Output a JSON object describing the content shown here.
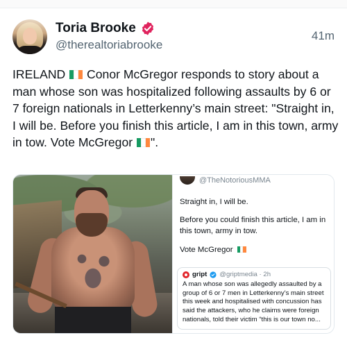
{
  "post": {
    "author_name": "Toria Brooke",
    "author_handle": "@therealtoriabrooke",
    "time": "41m",
    "text_parts": [
      "IRELAND",
      "Conor McGregor responds to story about a man whose son was hospitalized following assaults by 6 or 7 foreign nationals in Letterkenny’s main street: \"Straight in, I will be. Before you finish this article, I am in this town, army in tow. Vote McGregor",
      "\"."
    ]
  },
  "media": {
    "photo_icon": "man-holding-axe-photo",
    "quote": {
      "handle": "@TheNotoriousMMA",
      "line1": "Straight in, I will be.",
      "line2": "Before you could finish this article, I am in this town, army in tow.",
      "line3": "Vote McGregor",
      "inner": {
        "name": "gript",
        "meta": "@griptmedia · 2h",
        "text": "A man whose son was allegedly assaulted by a group of 6 or 7 men in Letterkenny’s main street this week and hospitalised with concussion has said the attackers, who he claims were foreign nationals, told their victim “this is our town no..."
      }
    }
  },
  "colors": {
    "verified_badge": "#e0245e",
    "flag_green": "#169b62",
    "flag_white": "#ffffff",
    "flag_orange": "#ff883e",
    "inner_verified": "#1d9bf0"
  }
}
